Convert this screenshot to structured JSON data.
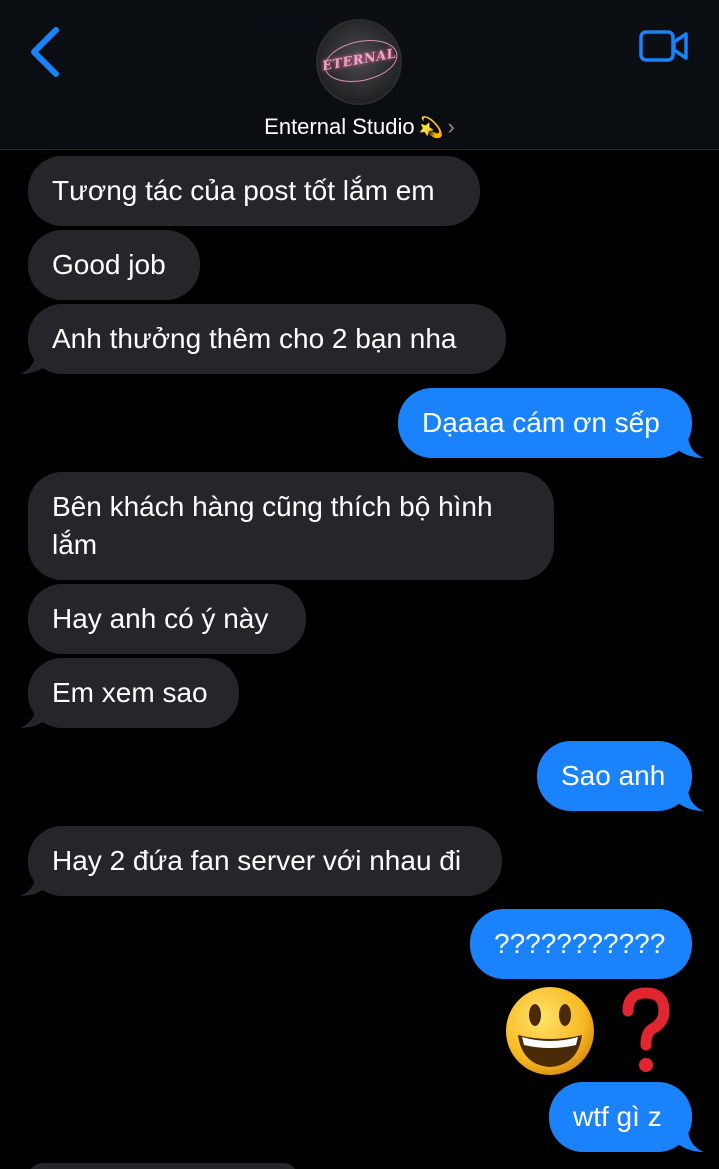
{
  "header": {
    "contact_name": "Enternal Studio",
    "contact_emoji": "💫",
    "chevron": "›",
    "avatar_logo_text": "ETERNAL",
    "icons": {
      "back": "chevron-left-icon",
      "video": "video-camera-icon"
    }
  },
  "colors": {
    "incoming_bubble": "#26252a",
    "outgoing_bubble": "#1a82fb",
    "accent": "#1a82fb",
    "background": "#000000"
  },
  "messages": [
    {
      "from": "them",
      "text": "Tương tác của post tốt lắm em"
    },
    {
      "from": "them",
      "text": "Good job"
    },
    {
      "from": "them",
      "text": "Anh thưởng thêm cho 2 bạn nha"
    },
    {
      "from": "me",
      "text": "Dạaaa cám ơn sếp"
    },
    {
      "from": "them",
      "text": "Bên khách hàng cũng thích bộ hình lắm"
    },
    {
      "from": "them",
      "text": "Hay anh có ý này"
    },
    {
      "from": "them",
      "text": "Em xem sao"
    },
    {
      "from": "me",
      "text": "Sao anh"
    },
    {
      "from": "them",
      "text": "Hay 2 đứa fan server với nhau đi"
    },
    {
      "from": "me",
      "text": "???????????"
    },
    {
      "from": "me",
      "emoji": [
        "😃",
        "❓"
      ]
    },
    {
      "from": "me",
      "text": "wtf gì z"
    }
  ]
}
